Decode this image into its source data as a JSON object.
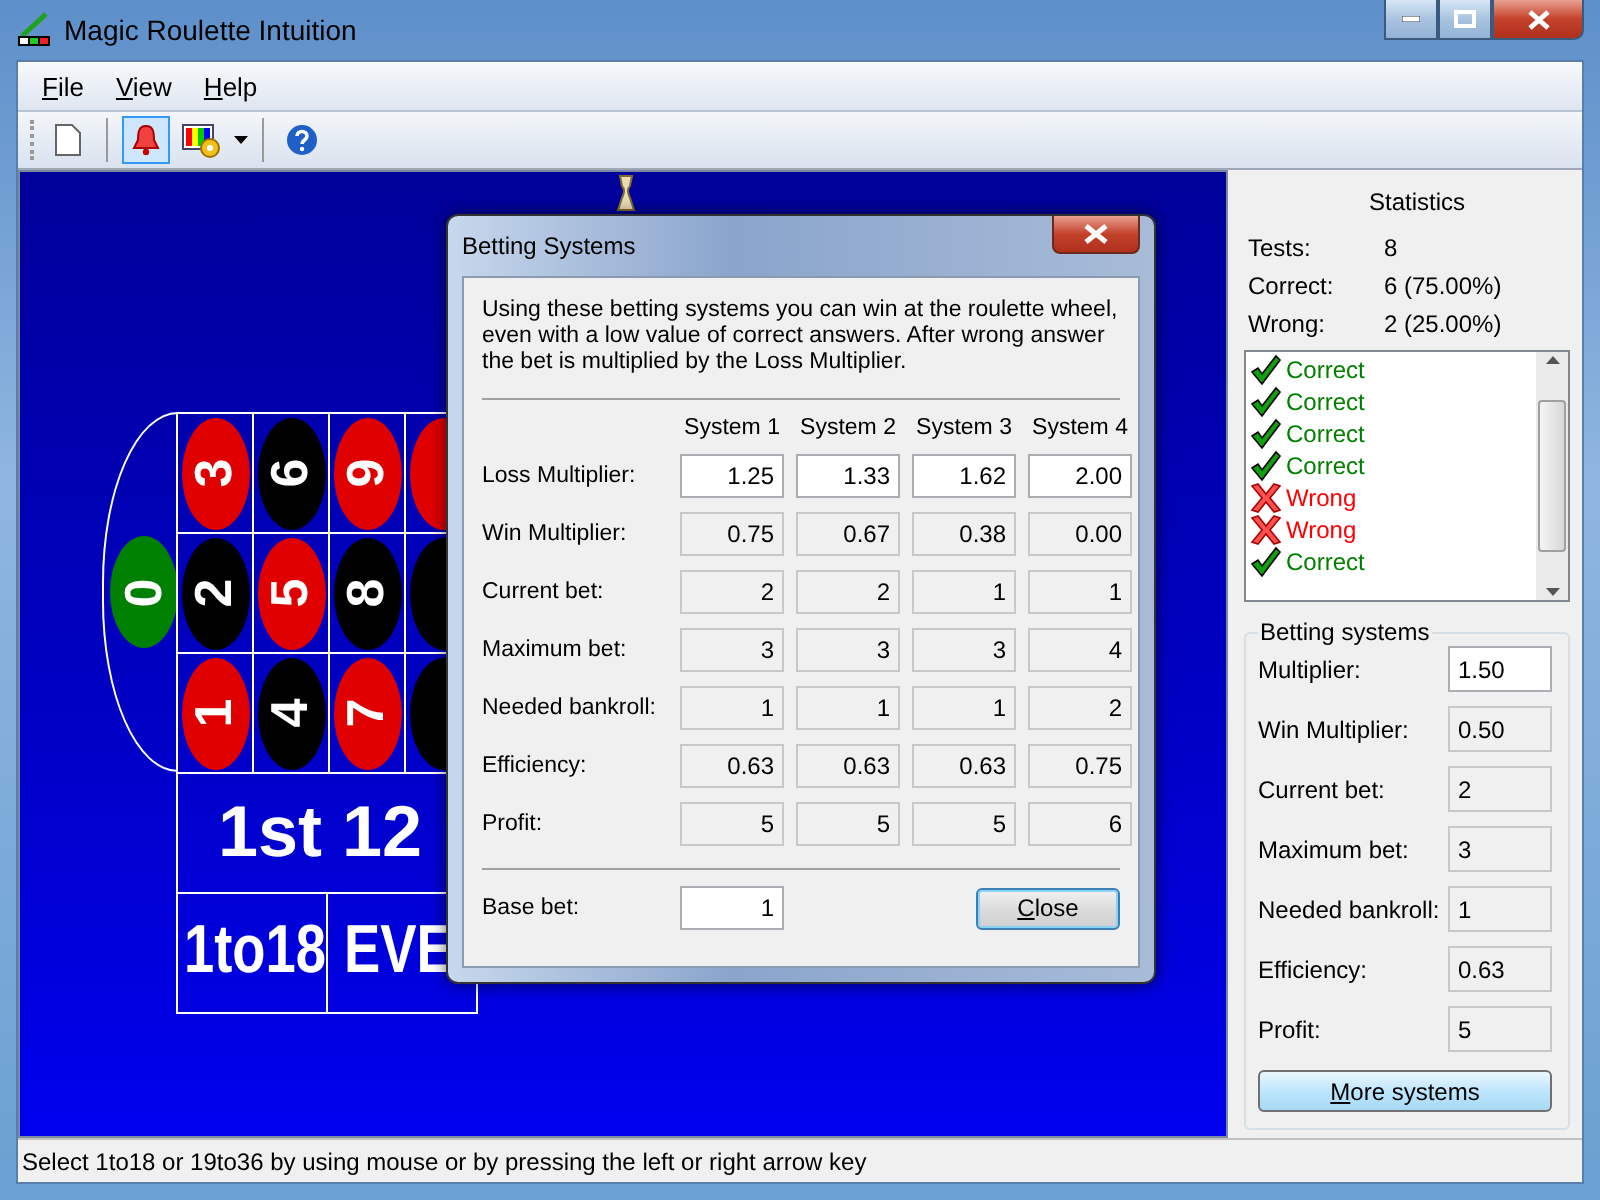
{
  "window": {
    "title": "Magic Roulette Intuition"
  },
  "menu": [
    {
      "label": "File"
    },
    {
      "label": "View"
    },
    {
      "label": "Help"
    }
  ],
  "toolbar": [
    {
      "kind": "new",
      "selected": false
    },
    {
      "kind": "bell",
      "selected": true
    },
    {
      "kind": "colors",
      "selected": false
    },
    {
      "kind": "help",
      "selected": false
    }
  ],
  "board": {
    "zero": "0",
    "rows": [
      [
        {
          "n": "3",
          "color": "#e00000"
        },
        {
          "n": "6",
          "color": "#000000"
        },
        {
          "n": "9",
          "color": "#e00000"
        },
        {
          "color": "#e00000"
        }
      ],
      [
        {
          "n": "2",
          "color": "#000000"
        },
        {
          "n": "5",
          "color": "#e00000"
        },
        {
          "n": "8",
          "color": "#000000"
        },
        {
          "color": "#000000"
        }
      ],
      [
        {
          "n": "1",
          "color": "#e00000"
        },
        {
          "n": "4",
          "color": "#000000"
        },
        {
          "n": "7",
          "color": "#e00000"
        },
        {
          "color": "#000000"
        }
      ]
    ],
    "dozen": "1st 12",
    "outside": [
      "1to18",
      "EVE"
    ]
  },
  "dialog": {
    "title": "Betting Systems",
    "description": "Using these betting systems you can win at the roulette wheel, even with a low value of correct answers. After wrong answer the bet is multiplied by the Loss Multiplier.",
    "columns": [
      "System 1",
      "System 2",
      "System 3",
      "System 4"
    ],
    "rows": [
      {
        "label": "Loss Multiplier:",
        "kind": "input",
        "values": [
          "1.25",
          "1.33",
          "1.62",
          "2.00"
        ]
      },
      {
        "label": "Win Multiplier:",
        "kind": "readonly",
        "values": [
          "0.75",
          "0.67",
          "0.38",
          "0.00"
        ]
      },
      {
        "label": "Current bet:",
        "kind": "readonly",
        "values": [
          "2",
          "2",
          "1",
          "1"
        ]
      },
      {
        "label": "Maximum bet:",
        "kind": "readonly",
        "values": [
          "3",
          "3",
          "3",
          "4"
        ]
      },
      {
        "label": "Needed bankroll:",
        "kind": "readonly",
        "values": [
          "1",
          "1",
          "1",
          "2"
        ]
      },
      {
        "label": "Efficiency:",
        "kind": "readonly",
        "values": [
          "0.63",
          "0.63",
          "0.63",
          "0.75"
        ]
      },
      {
        "label": "Profit:",
        "kind": "readonly",
        "values": [
          "5",
          "5",
          "5",
          "6"
        ]
      }
    ],
    "base_bet": {
      "label": "Base bet:",
      "value": "1"
    },
    "button": "Close"
  },
  "statistics": {
    "title": "Statistics",
    "rows": [
      {
        "label": "Tests:",
        "value": "8"
      },
      {
        "label": "Correct:",
        "value": "6 (75.00%)"
      },
      {
        "label": "Wrong:",
        "value": "2 (25.00%)"
      }
    ],
    "results": [
      {
        "kind": "correct",
        "label": "Correct"
      },
      {
        "kind": "correct",
        "label": "Correct"
      },
      {
        "kind": "correct",
        "label": "Correct"
      },
      {
        "kind": "correct",
        "label": "Correct"
      },
      {
        "kind": "wrong",
        "label": "Wrong"
      },
      {
        "kind": "wrong",
        "label": "Wrong"
      },
      {
        "kind": "correct",
        "label": "Correct"
      }
    ]
  },
  "betting": {
    "title": "Betting systems",
    "rows": [
      {
        "label": "Multiplier:",
        "kind": "input",
        "value": "1.50"
      },
      {
        "label": "Win Multiplier:",
        "kind": "readonly",
        "value": "0.50"
      },
      {
        "label": "Current bet:",
        "kind": "readonly",
        "value": "2"
      },
      {
        "label": "Maximum bet:",
        "kind": "readonly",
        "value": "3"
      },
      {
        "label": "Needed bankroll:",
        "kind": "readonly",
        "value": "1"
      },
      {
        "label": "Efficiency:",
        "kind": "readonly",
        "value": "0.63"
      },
      {
        "label": "Profit:",
        "kind": "readonly",
        "value": "5"
      }
    ],
    "button": "More systems"
  },
  "status_bar": "Select 1to18 or 19to36 by using mouse or by pressing the left or right arrow key"
}
